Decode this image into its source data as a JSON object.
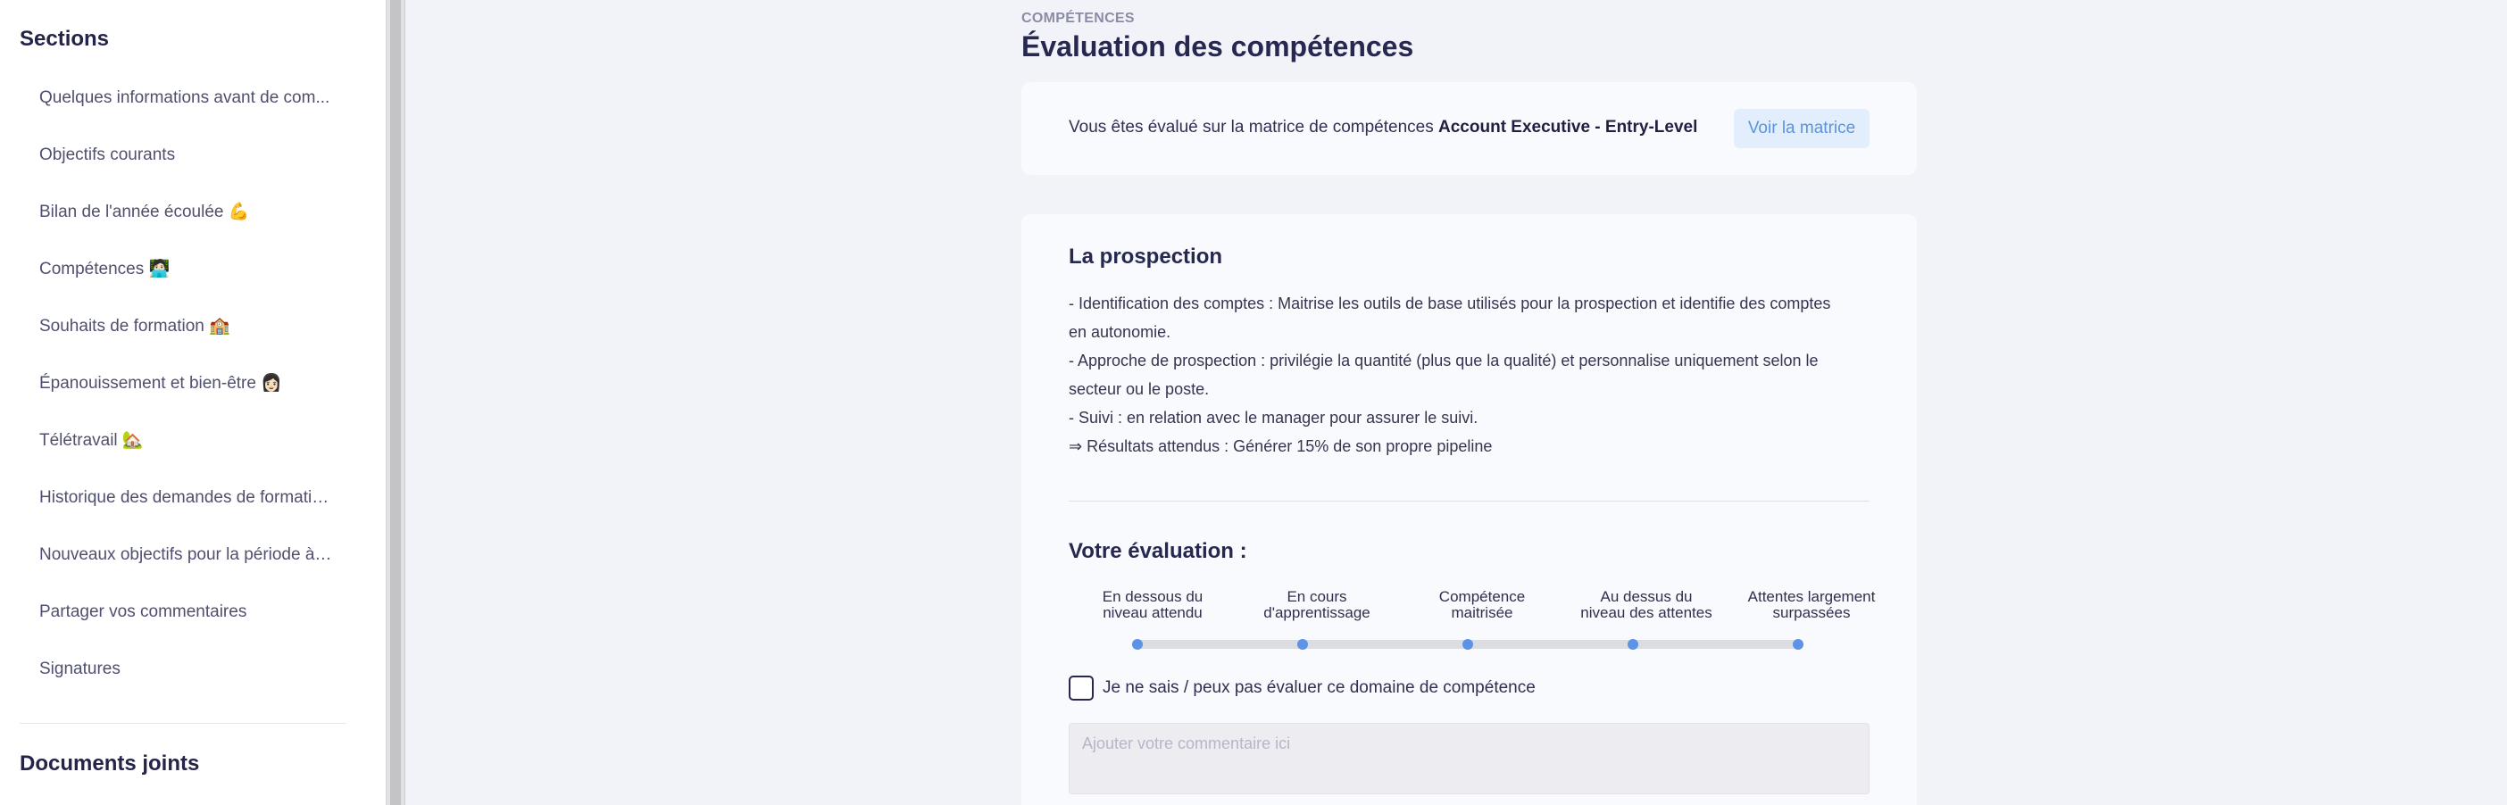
{
  "sidebar": {
    "title": "Sections",
    "items": [
      {
        "label": "Quelques informations avant de com..."
      },
      {
        "label": "Objectifs courants"
      },
      {
        "label": "Bilan de l'année écoulée 💪"
      },
      {
        "label": "Compétences 🧑🏻‍💻"
      },
      {
        "label": "Souhaits de formation 🏫"
      },
      {
        "label": "Épanouissement et bien-être 👩🏻"
      },
      {
        "label": "Télétravail 🏡"
      },
      {
        "label": "Historique des demandes de formatio..."
      },
      {
        "label": "Nouveaux objectifs pour la période à ..."
      },
      {
        "label": "Partager vos commentaires"
      },
      {
        "label": "Signatures"
      }
    ],
    "documents_title": "Documents joints"
  },
  "header": {
    "eyebrow": "COMPÉTENCES",
    "title": "Évaluation des compétences"
  },
  "matrix": {
    "text_prefix": "Vous êtes évalué sur la matrice de compétences ",
    "matrix_name": "Account Executive - Entry-Level",
    "button_label": "Voir la matrice"
  },
  "skill": {
    "title": "La prospection",
    "description": [
      "- Identification des comptes : Maitrise les outils de base utilisés pour la prospection et identifie des comptes",
      "en autonomie.",
      "- Approche de prospection : privilégie la quantité (plus que la qualité) et personnalise uniquement selon le",
      "secteur ou le poste.",
      "- Suivi : en relation avec le manager pour assurer le suivi.",
      "⇒ Résultats attendus : Générer 15% de son propre pipeline"
    ]
  },
  "evaluation": {
    "title": "Votre évaluation :",
    "levels": [
      {
        "line1": "En dessous du",
        "line2": "niveau attendu"
      },
      {
        "line1": "En cours",
        "line2": "d'apprentissage"
      },
      {
        "line1": "Compétence",
        "line2": "maitrisée"
      },
      {
        "line1": "Au dessus du",
        "line2": "niveau des attentes"
      },
      {
        "line1": "Attentes largement",
        "line2": "surpassées"
      }
    ],
    "checkbox_label": "Je ne sais / peux pas évaluer ce domaine de compétence",
    "comment_placeholder": "Ajouter votre commentaire ici"
  },
  "colors": {
    "accent": "#5d93e6",
    "background": "#f2f3f8",
    "card": "#f9fafd",
    "title": "#262850"
  }
}
